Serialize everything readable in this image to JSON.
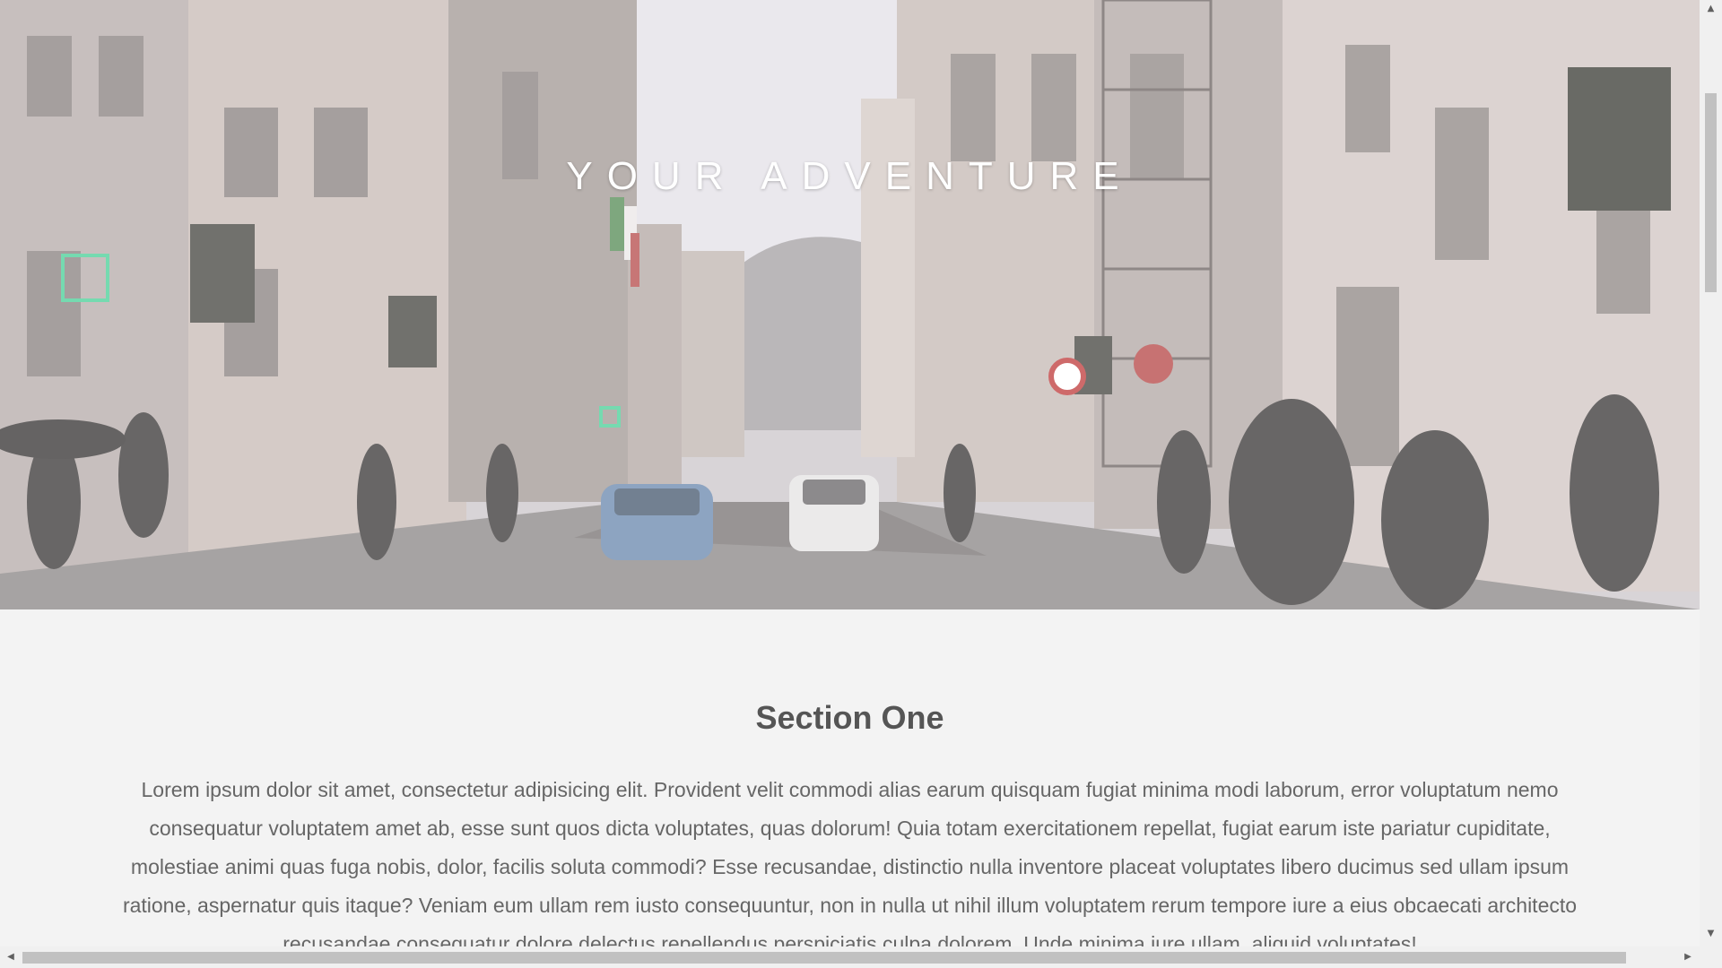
{
  "hero": {
    "title": "YOUR ADVENTURE"
  },
  "section": {
    "title": "Section One",
    "body": "Lorem ipsum dolor sit amet, consectetur adipisicing elit. Provident velit commodi alias earum quisquam fugiat minima modi laborum, error voluptatum nemo consequatur voluptatem amet ab, esse sunt quos dicta voluptates, quas dolorum! Quia totam exercitationem repellat, fugiat earum iste pariatur cupiditate, molestiae animi quas fuga nobis, dolor, facilis soluta commodi? Esse recusandae, distinctio nulla inventore placeat voluptates libero ducimus sed ullam ipsum ratione, aspernatur quis itaque? Veniam eum ullam rem iusto consequuntur, non in nulla ut nihil illum voluptatem rerum tempore iure a eius obcaecati architecto recusandae consequatur dolore delectus repellendus perspiciatis culpa dolorem. Unde minima iure ullam, aliquid voluptates!"
  },
  "scrollbars": {
    "up_arrow": "▲",
    "down_arrow": "▼",
    "left_arrow": "◀",
    "right_arrow": "▶"
  },
  "colors": {
    "page_background": "#f3f3f3",
    "heading": "#555555",
    "body_text": "#666666",
    "hero_title": "#ffffff"
  }
}
